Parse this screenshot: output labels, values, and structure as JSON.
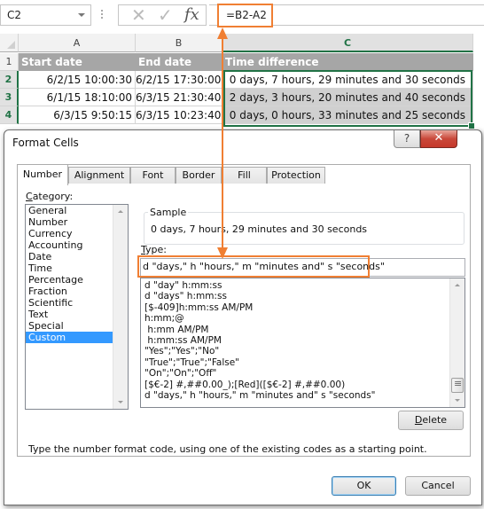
{
  "formula_bar": {
    "name_box": "C2",
    "cancel_icon": "✕",
    "enter_icon": "✓",
    "fx_label": "fx",
    "formula": "=B2-A2"
  },
  "sheet": {
    "columns": [
      "A",
      "B",
      "C"
    ],
    "rows": [
      "1",
      "2",
      "3",
      "4"
    ],
    "header_row": [
      "Start date",
      "End date",
      "Time difference"
    ],
    "data": [
      [
        "6/2/15 10:00:30",
        "6/2/15 17:30:00",
        "0 days, 7 hours, 29 minutes and 30 seconds"
      ],
      [
        "6/1/15 18:10:00",
        "6/3/15 21:30:40",
        "2 days, 3 hours, 20 minutes and 40 seconds"
      ],
      [
        "6/3/15 9:50:15",
        "6/3/15 10:23:40",
        "0 days, 0 hours, 33 minutes and 25 seconds"
      ]
    ],
    "selected_range": "C2:C4",
    "accent_color": "#217346"
  },
  "dialog": {
    "title": "Format Cells",
    "help_label": "?",
    "close_label": "✕",
    "tabs": [
      "Number",
      "Alignment",
      "Font",
      "Border",
      "Fill",
      "Protection"
    ],
    "active_tab": "Number",
    "category_label_first": "C",
    "category_label_rest": "ategory:",
    "categories": [
      "General",
      "Number",
      "Currency",
      "Accounting",
      "Date",
      "Time",
      "Percentage",
      "Fraction",
      "Scientific",
      "Text",
      "Special",
      "Custom"
    ],
    "selected_category": "Custom",
    "sample_label": "Sample",
    "sample_value": "0 days, 7 hours, 29 minutes and 30 seconds",
    "type_label_first": "T",
    "type_label_rest": "ype:",
    "type_value": "d \"days,\" h \"hours,\" m \"minutes and\" s \"seconds\"",
    "type_list": [
      "d \"day\" h:mm:ss",
      "d \"days\" h:mm:ss",
      "[$-409]h:mm:ss AM/PM",
      "h:mm;@",
      " h:mm AM/PM",
      " h:mm:ss AM/PM",
      "\"Yes\";\"Yes\";\"No\"",
      "\"True\";\"True\";\"False\"",
      "\"On\";\"On\";\"Off\"",
      "[$€-2] #,##0.00_);[Red]([$€-2] #,##0.00)",
      "d \"days,\" h \"hours,\" m \"minutes and\" s \"seconds\""
    ],
    "delete_label_first": "D",
    "delete_label_rest": "elete",
    "hint": "Type the number format code, using one of the existing codes as a starting point.",
    "ok_label": "OK",
    "cancel_label": "Cancel",
    "highlight_color": "#f07f33",
    "selection_color": "#3399ff"
  }
}
